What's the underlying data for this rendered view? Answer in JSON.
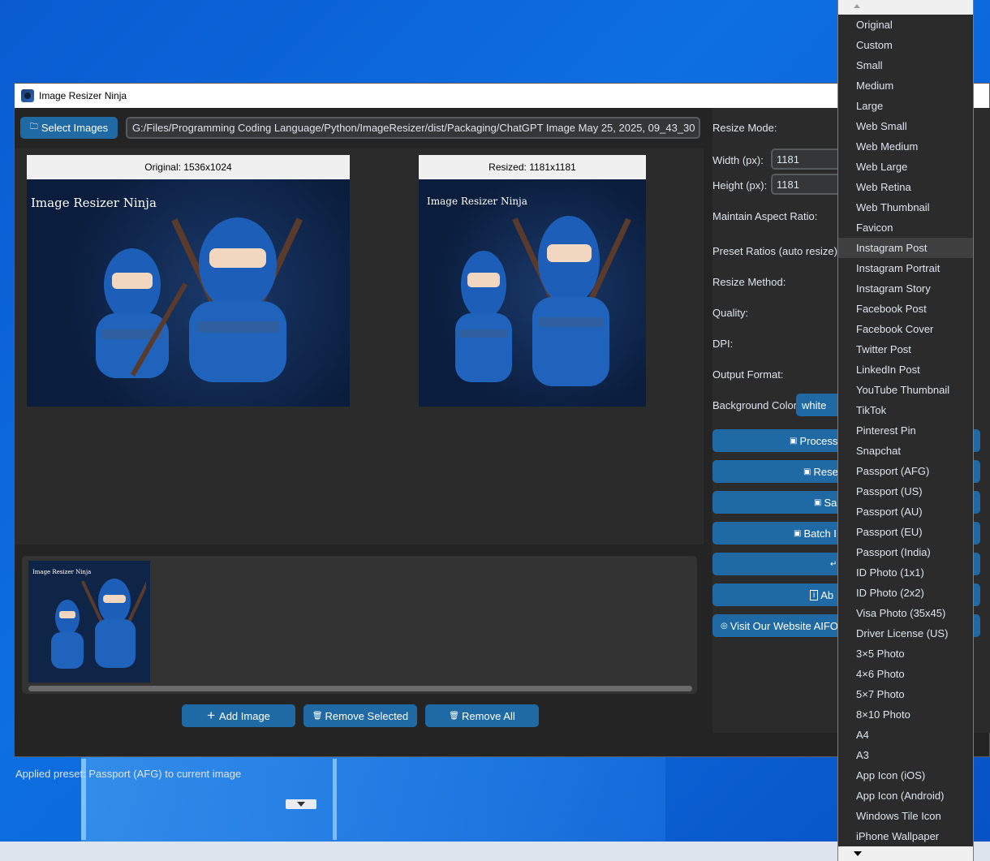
{
  "window": {
    "title": "Image Resizer Ninja"
  },
  "toolbar": {
    "select_images_label": "Select Images",
    "path": "G:/Files/Programming Coding Language/Python/ImageResizer/dist/Packaging/ChatGPT Image May 25, 2025, 09_43_30 PM"
  },
  "preview": {
    "original_label": "Original: 1536x1024",
    "resized_label": "Resized: 1181x1181",
    "image_text": "Image Resizer Ninja"
  },
  "bottom_buttons": {
    "add_image": "Add Image",
    "remove_selected": "Remove Selected",
    "remove_all": "Remove All"
  },
  "status": "Applied preset: Passport (AFG) to current image",
  "settings": {
    "resize_mode_label": "Resize Mode:",
    "width_label": "Width (px):",
    "width_value": "1181",
    "height_label": "Height (px):",
    "height_value": "1181",
    "aspect_label": "Maintain Aspect Ratio:",
    "preset_label": "Preset Ratios (auto resize):",
    "method_label": "Resize Method:",
    "quality_label": "Quality:",
    "dpi_label": "DPI:",
    "format_label": "Output Format:",
    "bg_label": "Background Color:",
    "bg_value": "white"
  },
  "action_buttons": [
    {
      "label": "Process"
    },
    {
      "label": "Rese"
    },
    {
      "label": "Sa"
    },
    {
      "label": "Batch I"
    },
    {
      "label": ""
    },
    {
      "label": "Ab"
    },
    {
      "label": "Visit Our Website AIFO"
    }
  ],
  "dropdown": {
    "highlighted": "Instagram Post",
    "options": [
      "Original",
      "Custom",
      "Small",
      "Medium",
      "Large",
      "Web Small",
      "Web Medium",
      "Web Large",
      "Web Retina",
      "Web Thumbnail",
      "Favicon",
      "Instagram Post",
      "Instagram Portrait",
      "Instagram Story",
      "Facebook Post",
      "Facebook Cover",
      "Twitter Post",
      "LinkedIn Post",
      "YouTube Thumbnail",
      "TikTok",
      "Pinterest Pin",
      "Snapchat",
      "Passport (AFG)",
      "Passport (US)",
      "Passport (AU)",
      "Passport (EU)",
      "Passport (India)",
      "ID Photo (1x1)",
      "ID Photo (2x2)",
      "Visa Photo (35x45)",
      "Driver License (US)",
      "3×5 Photo",
      "4×6 Photo",
      "5×7 Photo",
      "8×10 Photo",
      "A4",
      "A3",
      "App Icon (iOS)",
      "App Icon (Android)",
      "Windows Tile Icon",
      "iPhone Wallpaper"
    ]
  }
}
